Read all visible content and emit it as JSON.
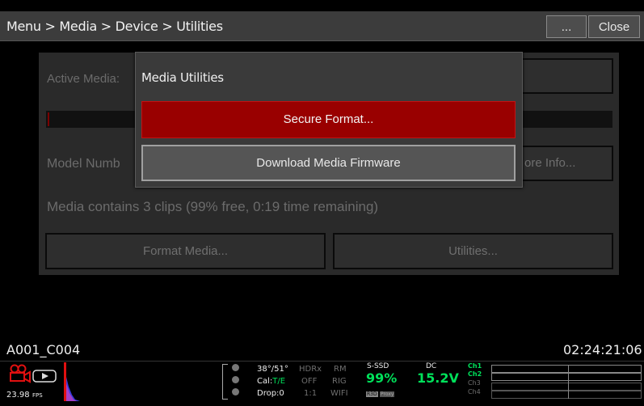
{
  "breadcrumb": "Menu > Media > Device > Utilities",
  "toolbar": {
    "more_label": "...",
    "close_label": "Close"
  },
  "media_panel": {
    "active_media_label": "Active Media:",
    "model_label": "Model Numb",
    "more_info_label": "ore Info...",
    "clips_info": "Media contains 3 clips (99% free, 0:19 time remaining)",
    "format_media_label": "Format Media...",
    "utilities_label": "Utilities..."
  },
  "modal": {
    "title": "Media Utilities",
    "secure_format_label": "Secure Format...",
    "download_firmware_label": "Download Media Firmware"
  },
  "clip_name": "A001_C004",
  "timecode": "02:24:21:06",
  "status": {
    "fps": "23.98",
    "fps_unit": "FPS",
    "temp": "38°/51°",
    "cal_prefix": "Cal:",
    "cal_value": "T/E",
    "drop": "Drop:0",
    "hdrx": "HDRx",
    "hdrx_value": "OFF",
    "ratio": "1:1",
    "rm": "RM",
    "rig": "RIG",
    "wifi": "WIFI",
    "media_type": "S-SSD",
    "media_pct": "99%",
    "r3d": "R3D",
    "proxy": "Proxy",
    "dc_label": "DC",
    "voltage": "15.2V",
    "channels": [
      "Ch1",
      "Ch2",
      "Ch3",
      "Ch4"
    ]
  },
  "colors": {
    "accent_red": "#990000",
    "status_green": "#00e05a"
  }
}
